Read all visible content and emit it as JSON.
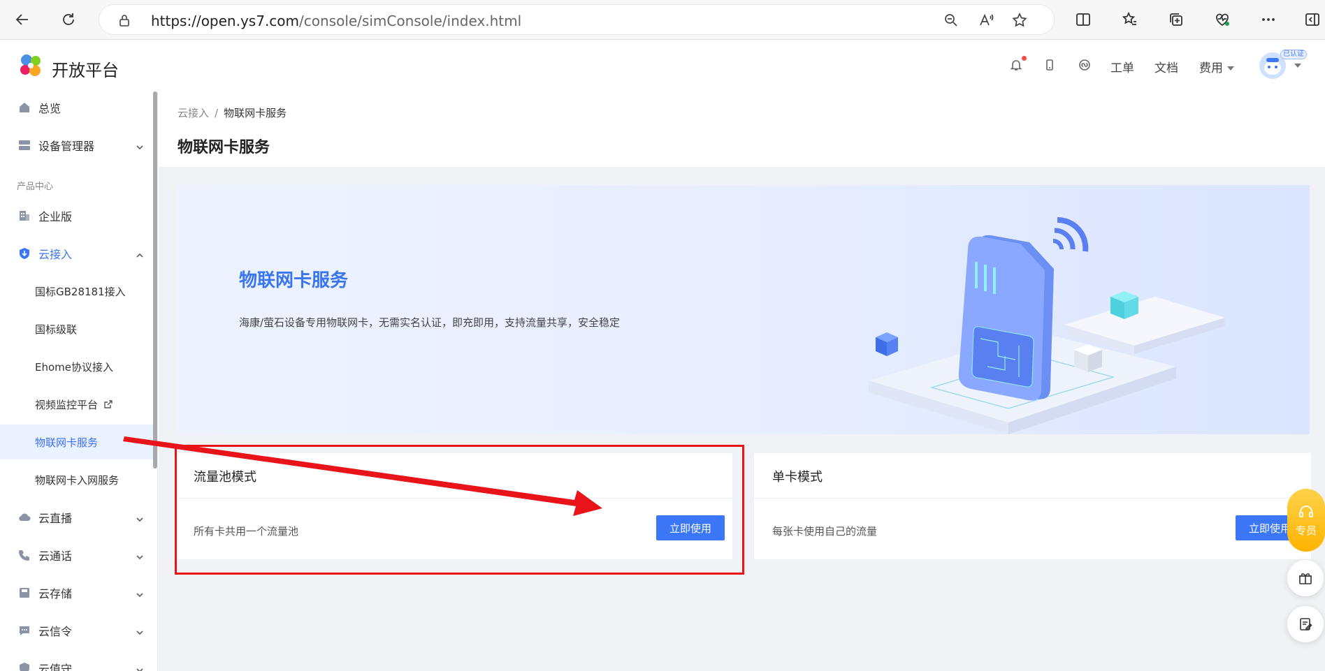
{
  "browser": {
    "url_host": "https://open.ys7.com",
    "url_path": "/console/simConsole/index.html"
  },
  "header": {
    "brand": "开放平台",
    "links": {
      "ticket": "工单",
      "docs": "文档",
      "billing": "费用"
    },
    "verified_badge": "已认证"
  },
  "sidebar": {
    "overview": "总览",
    "device_mgmt": "设备管理器",
    "section_product": "产品中心",
    "enterprise": "企业版",
    "cloud_access": "云接入",
    "sub": {
      "gb28181": "国标GB28181接入",
      "gb_cascade": "国标级联",
      "ehome": "Ehome协议接入",
      "video_platform": "视频监控平台",
      "iot_card": "物联网卡服务",
      "iot_card_net": "物联网卡入网服务"
    },
    "live": "云直播",
    "call": "云通话",
    "storage": "云存储",
    "signal": "云信令",
    "guard": "云值守"
  },
  "page": {
    "breadcrumb_parent": "云接入",
    "breadcrumb_sep": "/",
    "breadcrumb_current": "物联网卡服务",
    "title": "物联网卡服务"
  },
  "banner": {
    "title": "物联网卡服务",
    "desc": "海康/萤石设备专用物联网卡，无需实名认证，即充即用，支持流量共享，安全稳定"
  },
  "cards": {
    "pool": {
      "title": "流量池模式",
      "desc": "所有卡共用一个流量池",
      "button": "立即使用"
    },
    "single": {
      "title": "单卡模式",
      "desc": "每张卡使用自己的流量",
      "button": "立即使用"
    }
  },
  "floating": {
    "expert": "专员"
  },
  "colors": {
    "accent": "#3a76f6",
    "annotation": "#e8141a",
    "expert_bg": "#ffb300"
  }
}
